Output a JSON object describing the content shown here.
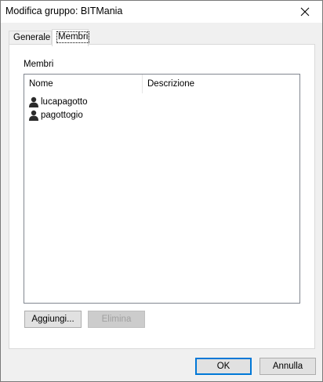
{
  "window": {
    "title": "Modifica gruppo: BITMania"
  },
  "tabs": [
    {
      "label": "Generale",
      "selected": false
    },
    {
      "label": "Membri",
      "selected": true
    }
  ],
  "members_section": {
    "label": "Membri",
    "columns": [
      "Nome",
      "Descrizione"
    ],
    "rows": [
      {
        "name": "lucapagotto",
        "description": "",
        "icon": "user-icon"
      },
      {
        "name": "pagottogio",
        "description": "",
        "icon": "user-icon"
      }
    ]
  },
  "buttons": {
    "add": "Aggiungi...",
    "remove": "Elimina",
    "ok": "OK",
    "cancel": "Annulla"
  },
  "colors": {
    "default_button_border": "#0078d7",
    "disabled_text": "#a0a0a0"
  }
}
